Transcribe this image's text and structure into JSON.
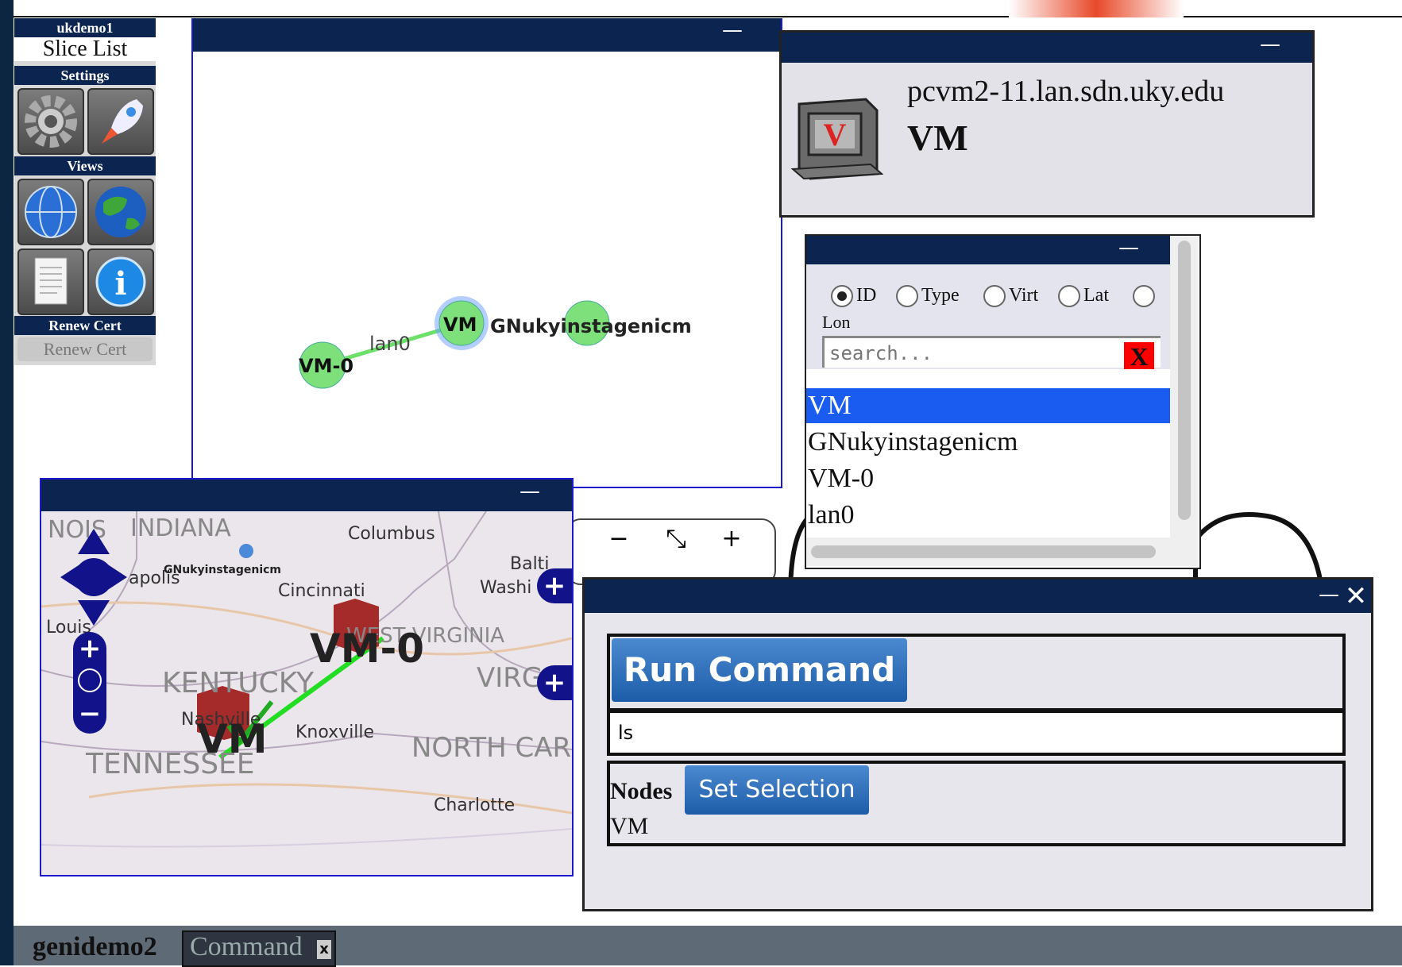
{
  "sidebar": {
    "user": "ukdemo1",
    "slice_list": "Slice List",
    "settings_header": "Settings",
    "views_header": "Views",
    "renew_header": "Renew Cert",
    "renew_button": "Renew Cert",
    "icons": [
      "gear-icon",
      "rocket-icon",
      "globe-icon",
      "earth-icon",
      "rspec-document-icon",
      "info-icon"
    ]
  },
  "topology": {
    "nodes": [
      "VM",
      "GNukyinstagenicm",
      "VM-0"
    ],
    "link": "lan0",
    "zoom_controls": [
      "−",
      "⤡",
      "+"
    ]
  },
  "host": {
    "hostname": "pcvm2-11.lan.sdn.uky.edu",
    "type": "VM",
    "icon_letter": "V"
  },
  "search_panel": {
    "filters": [
      "ID",
      "Type",
      "Virt",
      "Lat",
      "Lon"
    ],
    "selected_filter": "ID",
    "placeholder": "search...",
    "clear_label": "X",
    "items": [
      "VM",
      "GNukyinstagenicm",
      "VM-0",
      "lan0"
    ],
    "selected_item": "VM"
  },
  "map": {
    "labels": [
      "NOIS",
      "INDIANA",
      "Columbus",
      "Balti",
      "Washi",
      "apolis",
      "GNukyinstagenicm",
      "Cincinnati",
      "Louis",
      "WEST VIRGINIA",
      "VIRG",
      "KENTUCKY",
      "Nashville",
      "Knoxville",
      "NORTH CAR",
      "TENNESSEE",
      "Charlotte"
    ],
    "node_labels": [
      "VM-0",
      "VM"
    ],
    "plus": "+",
    "minus": "−"
  },
  "command": {
    "run_label": "Run Command",
    "command_value": "ls",
    "nodes_label": "Nodes",
    "set_selection_label": "Set Selection",
    "selected_nodes": "VM"
  },
  "bottom": {
    "slice": "genidemo2",
    "tab": "Command",
    "tab_close": "x"
  },
  "colors": {
    "titlebar": "#0b2550",
    "node_green": "#7ee07a",
    "selection_blue": "#1a5cf0",
    "button_blue": "#2a6ab5"
  }
}
